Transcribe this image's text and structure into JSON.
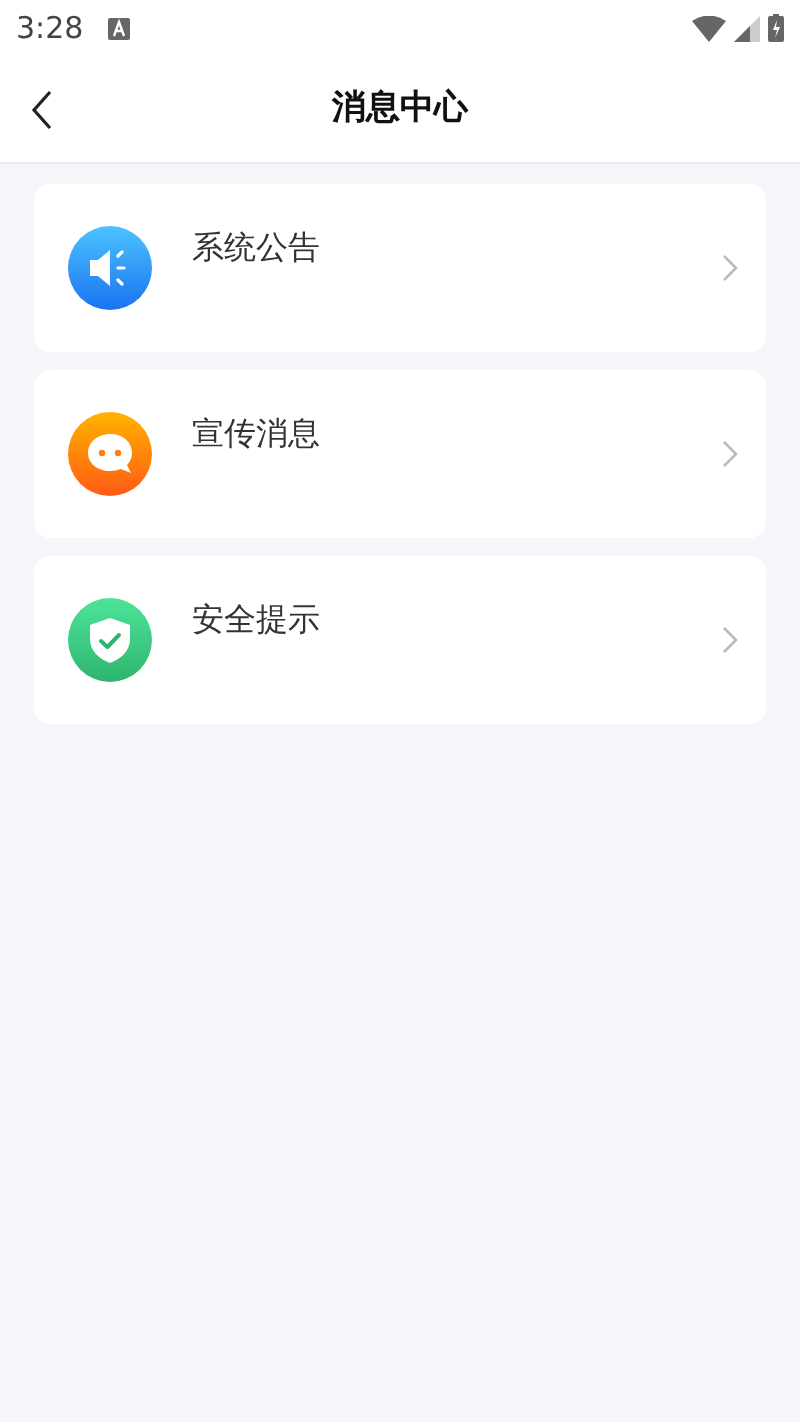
{
  "status_bar": {
    "time": "3:28"
  },
  "header": {
    "title": "消息中心"
  },
  "items": [
    {
      "kind": "announcement",
      "title": "系统公告"
    },
    {
      "kind": "chat",
      "title": "宣传消息"
    },
    {
      "kind": "security",
      "title": "安全提示"
    }
  ]
}
